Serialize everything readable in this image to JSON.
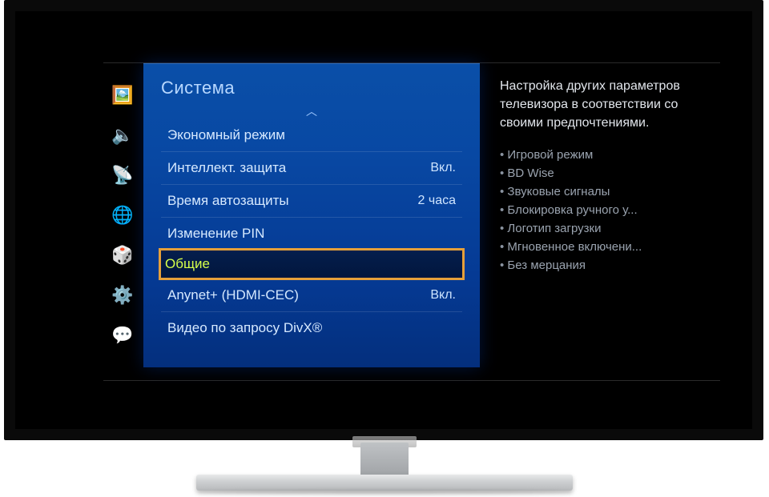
{
  "sidebar": {
    "icons": [
      {
        "name": "picture-icon",
        "glyph": "🖼️"
      },
      {
        "name": "sound-icon",
        "glyph": "🔈"
      },
      {
        "name": "network-icon",
        "glyph": "📡"
      },
      {
        "name": "smarthub-icon",
        "glyph": "🌐"
      },
      {
        "name": "apps-icon",
        "glyph": "🎲"
      },
      {
        "name": "system-icon",
        "glyph": "⚙️"
      },
      {
        "name": "support-icon",
        "glyph": "💬"
      }
    ]
  },
  "panel": {
    "title": "Система",
    "scroll_up_glyph": "︿",
    "items": [
      {
        "label": "Экономный режим",
        "value": ""
      },
      {
        "label": "Интеллект. защита",
        "value": "Вкл."
      },
      {
        "label": "Время автозащиты",
        "value": "2 часа"
      },
      {
        "label": "Изменение PIN",
        "value": ""
      },
      {
        "label": "Общие",
        "value": "",
        "selected": true
      },
      {
        "label": "Anynet+ (HDMI-CEC)",
        "value": "Вкл."
      },
      {
        "label": "Видео по запросу DivX®",
        "value": ""
      }
    ]
  },
  "description": {
    "text": "Настройка других параметров телевизора в соответствии со своими предпочтениями.",
    "bullets": [
      "Игровой режим",
      "BD Wise",
      "Звуковые сигналы",
      "Блокировка ручного у...",
      "Логотип загрузки",
      "Мгновенное включени...",
      "Без мерцания"
    ]
  }
}
